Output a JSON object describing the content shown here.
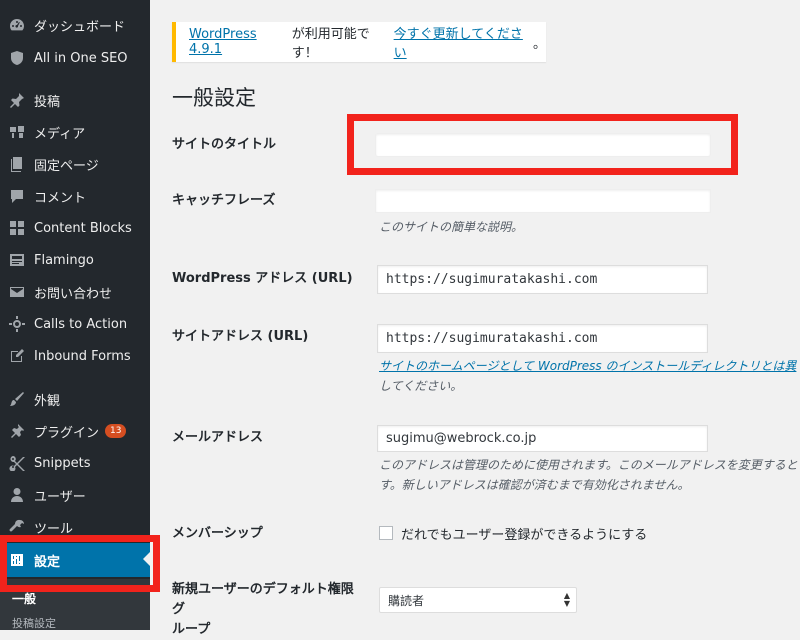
{
  "sidebar": {
    "items": [
      {
        "label": "ダッシュボード",
        "icon": "dashboard-icon"
      },
      {
        "label": "All in One SEO",
        "icon": "shield-icon"
      },
      {
        "label": "投稿",
        "icon": "pin-icon"
      },
      {
        "label": "メディア",
        "icon": "media-icon"
      },
      {
        "label": "固定ページ",
        "icon": "page-icon"
      },
      {
        "label": "コメント",
        "icon": "comment-icon"
      },
      {
        "label": "Content Blocks",
        "icon": "grid-icon"
      },
      {
        "label": "Flamingo",
        "icon": "flamingo-icon"
      },
      {
        "label": "お問い合わせ",
        "icon": "mail-icon"
      },
      {
        "label": "Calls to Action",
        "icon": "crosshair-icon"
      },
      {
        "label": "Inbound Forms",
        "icon": "edit-icon"
      },
      {
        "label": "外観",
        "icon": "brush-icon"
      },
      {
        "label": "プラグイン",
        "icon": "plugin-icon",
        "badge": "13"
      },
      {
        "label": "Snippets",
        "icon": "scissors-icon"
      },
      {
        "label": "ユーザー",
        "icon": "user-icon"
      },
      {
        "label": "ツール",
        "icon": "wrench-icon"
      },
      {
        "label": "設定",
        "icon": "settings-icon",
        "active": true
      }
    ],
    "submenu": {
      "current": "一般",
      "next": "投稿設定"
    }
  },
  "notice": {
    "version_link": "WordPress 4.9.1",
    "middle": " が利用可能です！",
    "update_link": "今すぐ更新してください",
    "end": "。"
  },
  "page_title": "一般設定",
  "fields": {
    "site_title": {
      "label": "サイトのタイトル",
      "value": ""
    },
    "tagline": {
      "label": "キャッチフレーズ",
      "value": "",
      "description": "このサイトの簡単な説明。"
    },
    "wp_address": {
      "label": "WordPress アドレス (URL)",
      "value": "https://sugimuratakashi.com"
    },
    "site_address": {
      "label": "サイトアドレス (URL)",
      "value": "https://sugimuratakashi.com",
      "description_link": "サイトのホームページとして WordPress のインストールディレクトリとは異",
      "description_cont": "してください。"
    },
    "email": {
      "label": "メールアドレス",
      "value": "sugimu@webrock.co.jp",
      "description_line1": "このアドレスは管理のために使用されます。このメールアドレスを変更すると",
      "description_line2": "す。新しいアドレスは確認が済むまで有効化されません。"
    },
    "membership": {
      "label": "メンバーシップ",
      "checkbox_label": "だれでもユーザー登録ができるようにする",
      "checked": false
    },
    "default_role": {
      "label_line1": "新規ユーザーのデフォルト権限グ",
      "label_line2": "ループ",
      "selected": "購読者"
    }
  },
  "colors": {
    "sidebar_bg": "#23282d",
    "active_bg": "#0073aa",
    "highlight": "#f2231c",
    "notice_border": "#ffb900",
    "badge": "#d54e21"
  }
}
